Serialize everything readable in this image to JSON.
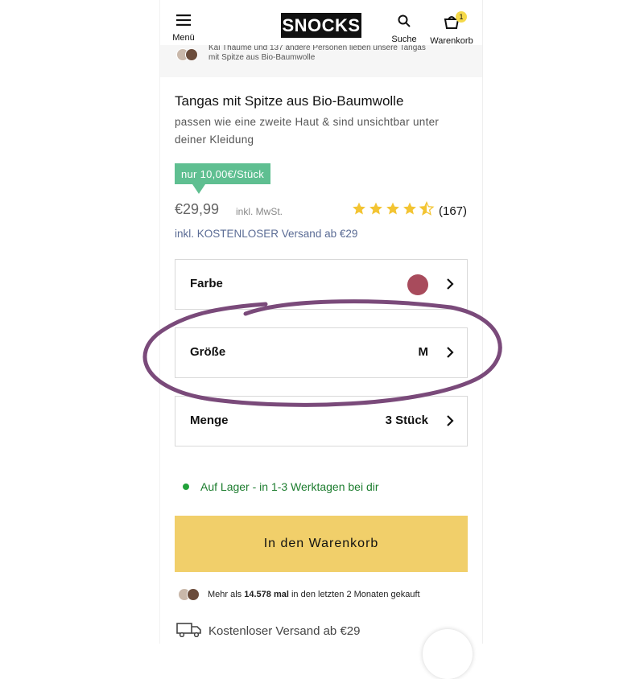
{
  "header": {
    "menu_label": "Menü",
    "logo_text": "SNOCKS",
    "search_label": "Suche",
    "cart_label": "Warenkorb",
    "cart_count": "1"
  },
  "social_top": {
    "line1": "Kai Thaume und 137 andere Personen lieben unsere Tangas",
    "line2": "mit Spitze aus Bio-Baumwolle"
  },
  "product": {
    "title": "Tangas mit Spitze aus Bio-Baumwolle",
    "subtitle": "passen wie eine zweite Haut & sind unsichtbar unter deiner Kleidung",
    "badge": "nur 10,00€/Stück",
    "price": "€29,99",
    "vat_note": "inkl. MwSt.",
    "rating": 4.5,
    "rating_count": "(167)",
    "shipping_note": "inkl. KOSTENLOSER Versand ab €29"
  },
  "options": {
    "color_label": "Farbe",
    "color_value": "#a84b5c",
    "size_label": "Größe",
    "size_value": "M",
    "quantity_label": "Menge",
    "quantity_value": "3 Stück"
  },
  "stock": {
    "text": "Auf Lager - in 1-3 Werktagen bei dir"
  },
  "cta": {
    "label": "In den Warenkorb"
  },
  "proof": {
    "prefix": "Mehr als",
    "count": "14.578 mal",
    "suffix": "in den letzten 2 Monaten gekauft"
  },
  "free_shipping": {
    "text": "Kostenloser Versand ab €29"
  },
  "colors": {
    "badge_green": "#5fbf91",
    "cta_yellow": "#f1cf6a",
    "stock_green": "#1d7d2f",
    "annotation_purple": "#7a4a7a",
    "star_yellow": "#f3c432"
  },
  "icons": [
    "hamburger-icon",
    "search-icon",
    "cart-icon",
    "chevron-right-icon",
    "truck-icon",
    "star-icon"
  ]
}
